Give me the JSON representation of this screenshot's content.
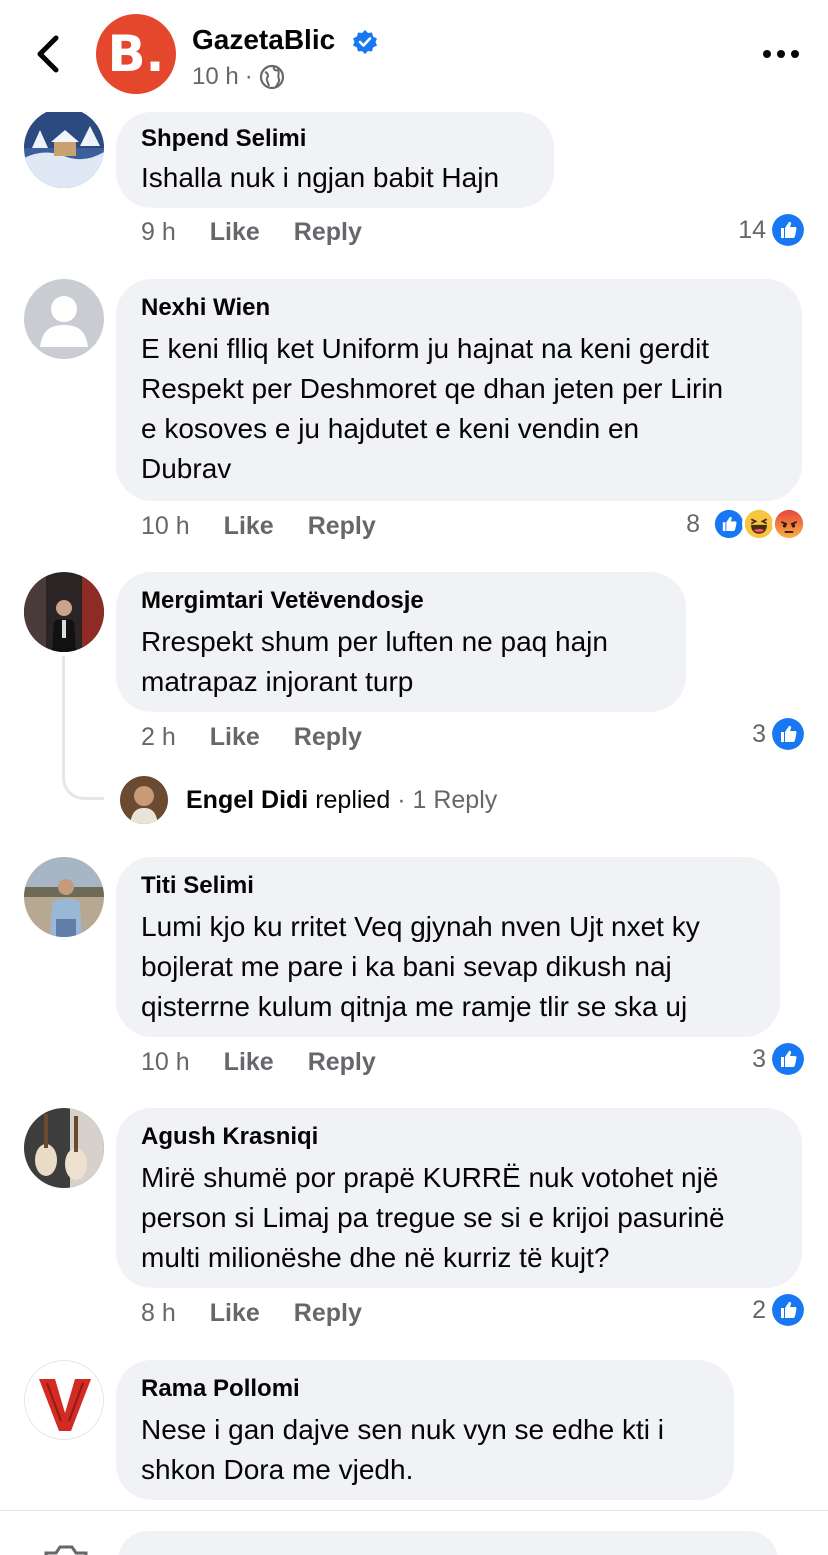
{
  "header": {
    "page_name": "GazetaBlic",
    "avatar_letter": "B.",
    "time": "10 h",
    "separator": "·"
  },
  "comments": [
    {
      "author": "Shpend Selimi",
      "text": "Ishalla nuk i ngjan babit Hajn",
      "time": "9 h",
      "like": "Like",
      "reply": "Reply",
      "reaction_count": "14",
      "reactions": [
        "like-icon"
      ]
    },
    {
      "author": "Nexhi Wien",
      "text": "E keni flliq ket Uniform ju hajnat  na keni gerdit\nRespekt per Deshmoret qe dhan jeten per Lirin\ne kosoves e ju hajdutet e keni vendin en\nDubrav",
      "time": "10 h",
      "like": "Like",
      "reply": "Reply",
      "reaction_count": "8",
      "reactions": [
        "like-icon",
        "haha-icon",
        "angry-icon"
      ]
    },
    {
      "author": "Mergimtari Vetëvendosje",
      "text": "Rrespekt shum per luften  ne paq hajn\nmatrapaz injorant turp",
      "time": "2 h",
      "like": "Like",
      "reply": "Reply",
      "reaction_count": "3",
      "reactions": [
        "like-icon"
      ]
    },
    {
      "author": "Titi Selimi",
      "text": "Lumi kjo ku rritet Veq gjynah nven Ujt nxet ky\nbojlerat me pare i ka bani sevap dikush naj\nqisterrne kulum qitnja me ramje tlir se ska uj",
      "time": "10 h",
      "like": "Like",
      "reply": "Reply",
      "reaction_count": "3",
      "reactions": [
        "like-icon"
      ]
    },
    {
      "author": "Agush Krasniqi",
      "text": "Mirë shumë por prapë KURRË nuk votohet një\nperson si Limaj pa tregue se si e krijoi pasurinë\nmulti milionëshe dhe në kurriz të kujt?",
      "time": "8 h",
      "like": "Like",
      "reply": "Reply",
      "reaction_count": "2",
      "reactions": [
        "like-icon"
      ]
    },
    {
      "author": "Rama Pollomi",
      "text": "Nese i gan dajve sen nuk vyn se edhe kti i\nshkon Dora me vjedh.",
      "time": "",
      "like": "",
      "reply": "",
      "reaction_count": "",
      "reactions": []
    }
  ],
  "reply_summary": {
    "author": "Engel Didi",
    "verb": "replied",
    "separator": "·",
    "count_label": "1 Reply"
  },
  "composer": {
    "placeholder": ""
  },
  "colors": {
    "brand": "#e4472c",
    "like_blue": "#1877f2",
    "bubble": "#f0f2f5",
    "muted": "#65676b"
  }
}
